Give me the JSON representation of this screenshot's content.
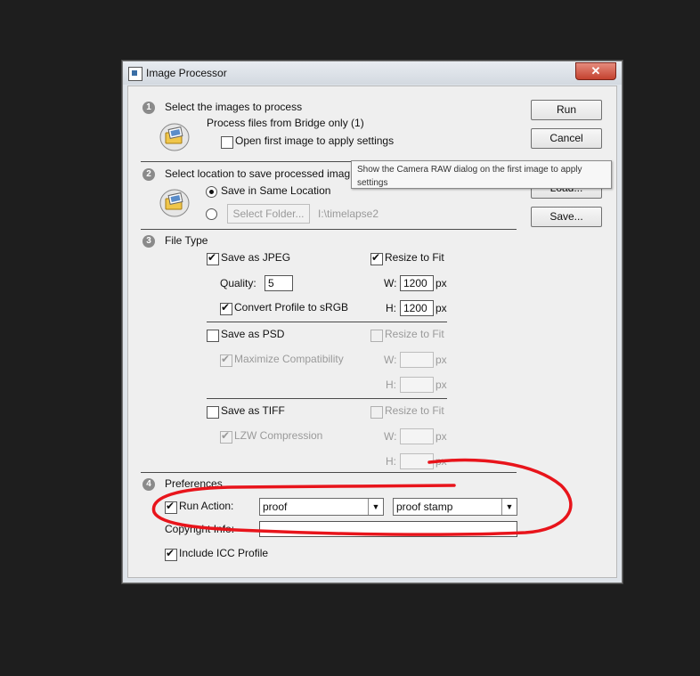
{
  "window": {
    "title": "Image Processor",
    "close_label": "✕"
  },
  "section1": {
    "number": "1",
    "heading": "Select the images to process",
    "source_text": "Process files from Bridge only (1)",
    "open_first_label": "Open first image to apply settings"
  },
  "section2": {
    "number": "2",
    "heading": "Select location to save processed imag",
    "same_location_label": "Save in Same Location",
    "select_folder_label": "Select Folder...",
    "folder_path": "I:\\timelapse2"
  },
  "section3": {
    "number": "3",
    "heading": "File Type",
    "jpeg": {
      "save_label": "Save as JPEG",
      "resize_label": "Resize to Fit",
      "quality_label": "Quality:",
      "quality_value": "5",
      "w_label": "W:",
      "w_value": "1200",
      "h_label": "H:",
      "h_value": "1200",
      "unit": "px",
      "convert_label": "Convert Profile to sRGB"
    },
    "psd": {
      "save_label": "Save as PSD",
      "resize_label": "Resize to Fit",
      "maximize_label": "Maximize Compatibility",
      "w_label": "W:",
      "h_label": "H:",
      "unit": "px"
    },
    "tiff": {
      "save_label": "Save as TIFF",
      "resize_label": "Resize to Fit",
      "lzw_label": "LZW Compression",
      "w_label": "W:",
      "h_label": "H:",
      "unit": "px"
    }
  },
  "section4": {
    "number": "4",
    "heading": "Preferences",
    "run_action_label": "Run Action:",
    "action_set": "proof",
    "action": "proof stamp",
    "copyright_label": "Copyright Info:",
    "copyright_value": "",
    "icc_label": "Include ICC Profile"
  },
  "buttons": {
    "run": "Run",
    "cancel": "Cancel",
    "load": "Load...",
    "save": "Save..."
  },
  "tooltip": {
    "text": "Show the Camera RAW dialog on the first image to apply settings"
  },
  "annotation": {
    "color": "#e8141b"
  }
}
